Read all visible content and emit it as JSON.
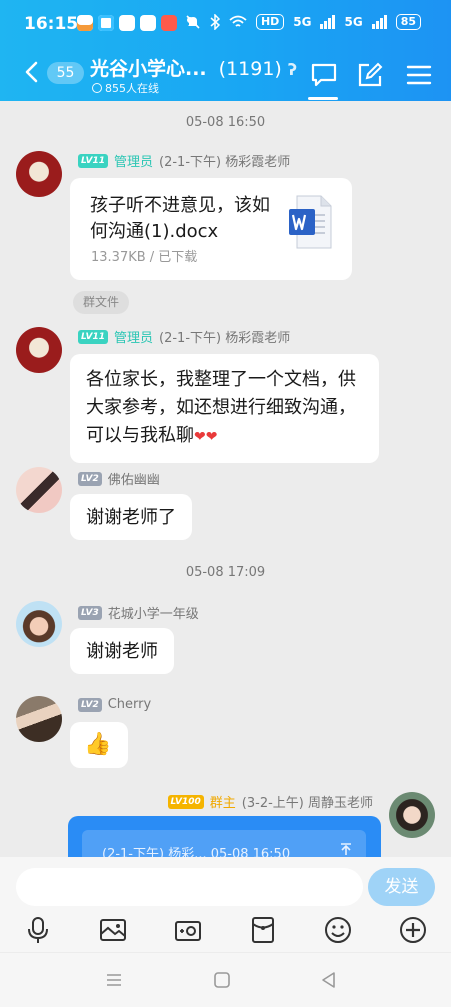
{
  "status_bar": {
    "time": "16:15",
    "hd_label": "HD",
    "network_1": "5G",
    "network_2": "5G",
    "battery": "85"
  },
  "header": {
    "unread_count": "55",
    "title": "光谷小学心...",
    "member_count": "(1191)",
    "online": "855人在线",
    "accent_color": "#19a6f3"
  },
  "messages": [
    {
      "timestamp": "05-08 16:50",
      "level": "LV11",
      "role": "管理员",
      "sender": "(2-1-下午) 杨彩霞老师",
      "file_name": "孩子听不进意见，该如何沟通(1).docx",
      "file_meta": "13.37KB / 已下载",
      "tag": "群文件"
    },
    {
      "level": "LV11",
      "role": "管理员",
      "sender": "(2-1-下午) 杨彩霞老师",
      "text": "各位家长，我整理了一个文档，供大家参考，如还想进行细致沟通，可以与我私聊",
      "emoji": "❤❤"
    },
    {
      "level": "LV2",
      "sender": "佛佑幽幽",
      "text": "谢谢老师了"
    },
    {
      "timestamp": "05-08 17:09",
      "level": "LV3",
      "sender": "花城小学一年级",
      "text": "谢谢老师"
    },
    {
      "level": "LV2",
      "sender": "Cherry",
      "text": "👍"
    },
    {
      "level": "LV100",
      "role": "群主",
      "sender": "(3-2-上午) 周静玉老师",
      "quote": "(2-1-下午) 杨彩...  05-08 16:50"
    }
  ],
  "composer": {
    "send_label": "发送"
  }
}
